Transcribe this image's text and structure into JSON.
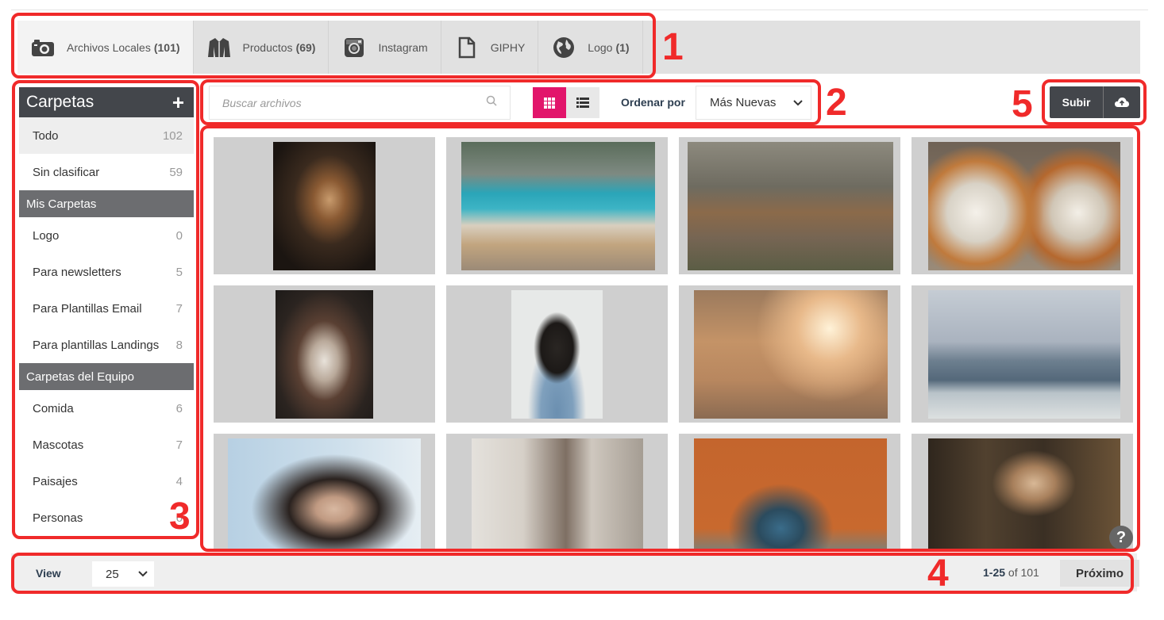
{
  "tabs": [
    {
      "label": "Archivos Locales",
      "count": "(101)",
      "icon": "camera-icon",
      "active": true
    },
    {
      "label": "Productos",
      "count": "(69)",
      "icon": "jacket-icon",
      "active": false
    },
    {
      "label": "Instagram",
      "count": "",
      "icon": "instagram-icon",
      "active": false
    },
    {
      "label": "GIPHY",
      "count": "",
      "icon": "file-icon",
      "active": false
    },
    {
      "label": "Logo",
      "count": "(1)",
      "icon": "globe-icon",
      "active": false
    }
  ],
  "sidebar": {
    "title": "Carpetas",
    "add": "+",
    "items": [
      {
        "label": "Todo",
        "count": "102"
      },
      {
        "label": "Sin clasificar",
        "count": "59"
      }
    ],
    "my_section": "Mis Carpetas",
    "my_folders": [
      {
        "label": "Logo",
        "count": "0"
      },
      {
        "label": "Para newsletters",
        "count": "5"
      },
      {
        "label": "Para Plantillas Email",
        "count": "7"
      },
      {
        "label": "Para plantillas Landings",
        "count": "8"
      }
    ],
    "team_section": "Carpetas del Equipo",
    "team_folders": [
      {
        "label": "Comida",
        "count": "6"
      },
      {
        "label": "Mascotas",
        "count": "7"
      },
      {
        "label": "Paisajes",
        "count": "4"
      },
      {
        "label": "Personas",
        "count": "6"
      }
    ]
  },
  "toolbar": {
    "search_placeholder": "Buscar archivos",
    "sort_label": "Ordenar por",
    "sort_value": "Más Nuevas",
    "upload_label": "Subir"
  },
  "gallery": [
    {
      "name": "puppy-yawning-photo"
    },
    {
      "name": "two-golden-dogs-lake-photo"
    },
    {
      "name": "three-puppies-photo"
    },
    {
      "name": "two-corgis-photo"
    },
    {
      "name": "husky-photo"
    },
    {
      "name": "pug-denim-photo"
    },
    {
      "name": "corgi-and-terrier-running-photo"
    },
    {
      "name": "couple-rooftop-city-photo"
    },
    {
      "name": "woman-hair-wind-photo"
    },
    {
      "name": "woman-cafe-photo"
    },
    {
      "name": "man-motorcycle-orange-wall-photo"
    },
    {
      "name": "woman-forest-photo"
    }
  ],
  "footer": {
    "view_label": "View",
    "per_page": "25",
    "range_bold": "1-25",
    "range_rest": " of 101",
    "next_label": "Próximo"
  },
  "help_label": "?",
  "annotations": [
    "1",
    "2",
    "3",
    "4",
    "5"
  ],
  "colors": {
    "accent": "#e2156b",
    "dark": "#43464b",
    "annotation": "#f02a2a"
  }
}
